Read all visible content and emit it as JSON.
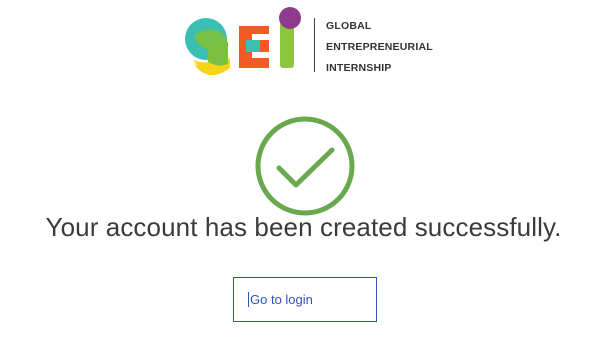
{
  "logo": {
    "mark_letters": "gEI",
    "line1": "GLOBAL",
    "line2": "ENTREPRENEURIAL",
    "line3": "INTERNSHIP",
    "colors": {
      "teal": "#3cbfb3",
      "green": "#7ac142",
      "yellow": "#f7d417",
      "orange": "#f15a24",
      "purple": "#8e3a8e",
      "lime": "#8cc63f"
    }
  },
  "status": {
    "icon": "check-circle-icon",
    "icon_color": "#6aa84f",
    "message": "Your account has been created successfully."
  },
  "actions": {
    "login_label": "Go to login",
    "accent": "#2f56b8"
  }
}
